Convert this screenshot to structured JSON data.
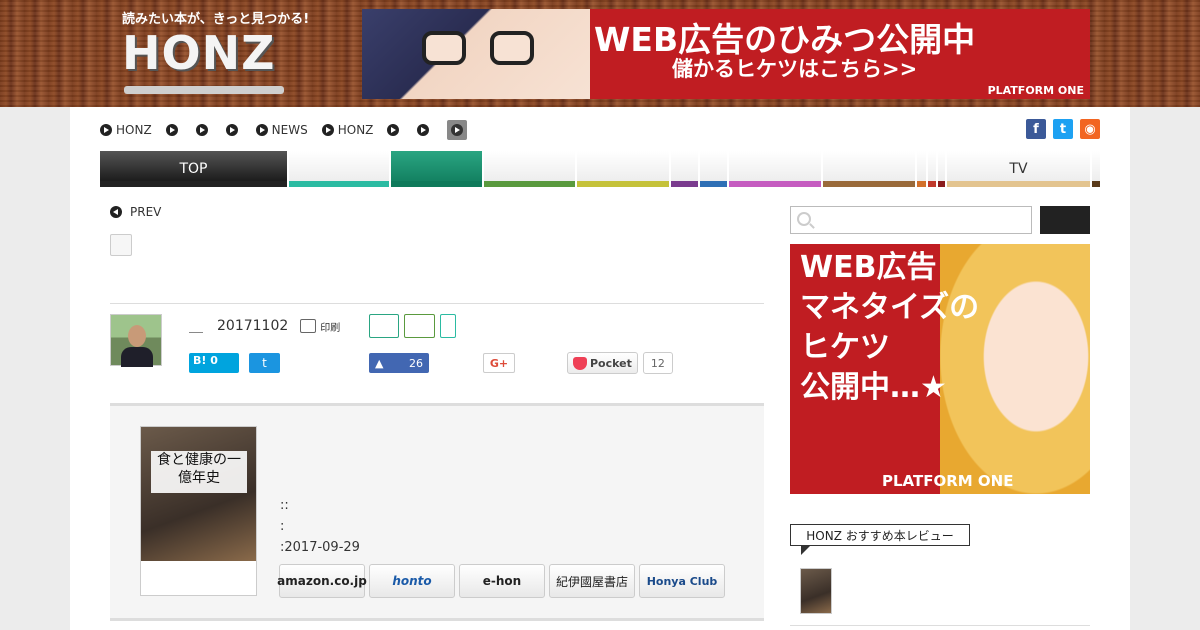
{
  "header": {
    "tagline": "読みたい本が、きっと見つかる!",
    "logo": "HONZ",
    "banner": {
      "line1": "WEB広告のひみつ公開中",
      "line2": "儲かるヒケツはこちら>>",
      "brand": "PLATFORM ONE"
    }
  },
  "breadcrumb": [
    {
      "label": "HONZ"
    },
    {
      "label": ""
    },
    {
      "label": ""
    },
    {
      "label": ""
    },
    {
      "label": "NEWS"
    },
    {
      "label": "HONZ"
    },
    {
      "label": ""
    },
    {
      "label": ""
    }
  ],
  "social_icons": [
    {
      "icon": "facebook-icon",
      "glyph": "f",
      "color": "#3b5998"
    },
    {
      "icon": "twitter-icon",
      "glyph": "t",
      "color": "#1da1f2"
    },
    {
      "icon": "rss-icon",
      "glyph": "◉",
      "color": "#f26522"
    }
  ],
  "nav": {
    "tabs": [
      {
        "label": "TOP",
        "color": "#222222",
        "active": true
      },
      {
        "label": "",
        "color": "#2bbba2"
      },
      {
        "label": "",
        "color": "#0f7a5b",
        "green": true
      },
      {
        "label": "",
        "color": "#5a9a3e"
      },
      {
        "label": "",
        "color": "#c5c23a"
      },
      {
        "label": "",
        "color": "#7a3b8e"
      },
      {
        "label": "",
        "color": "#2e6fb5"
      },
      {
        "label": "",
        "color": "#c55cc0"
      },
      {
        "label": "",
        "color": "#9a6a3a"
      },
      {
        "label": "",
        "color": "#d2702a"
      },
      {
        "label": "",
        "color": "#c0392b"
      },
      {
        "label": "",
        "color": "#8b1c1c"
      },
      {
        "label": "TV",
        "color": "#e3c48f"
      },
      {
        "label": "",
        "color": "#5a3a1a"
      }
    ]
  },
  "article": {
    "prev_label": "PREV",
    "author_sep": "＿",
    "date": "20171102",
    "print_label": "印刷",
    "share": {
      "hatena_label": "B! 0",
      "twitter_glyph": "t",
      "fb_count": "26",
      "gplus_label": "G+",
      "pocket_label": "Pocket",
      "pocket_count": "12"
    }
  },
  "book": {
    "cover_title": "食と健康の一億年史",
    "meta_line1": "::",
    "meta_line2": ":",
    "meta_line3": ":2017-09-29",
    "shops": [
      {
        "label": "amazon.co.jp"
      },
      {
        "label": "honto"
      },
      {
        "label": "e-hon"
      },
      {
        "label": "紀伊國屋書店"
      },
      {
        "label": "Honya Club"
      }
    ]
  },
  "sidebar": {
    "search_placeholder": "",
    "banner": {
      "line1": "WEB広告",
      "line2": "マネタイズの",
      "line3": "ヒケツ",
      "line4": "公開中…★",
      "brand": "PLATFORM ONE"
    },
    "recommend_heading": "HONZ おすすめ本レビュー"
  }
}
